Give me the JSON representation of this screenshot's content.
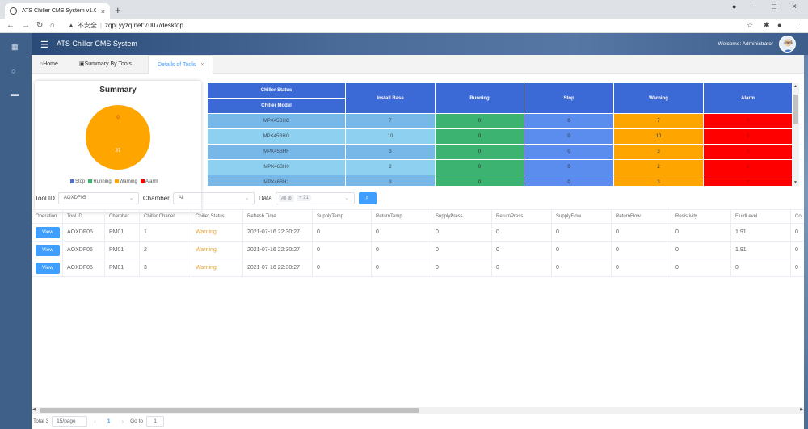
{
  "browser": {
    "tab_title": "ATS Chiller CMS System v1.0",
    "tab_close": "×",
    "new_tab": "+",
    "security_label": "不安全",
    "separator": "|",
    "url": "zqpj.yyzq.net:7007/desktop",
    "window_min": "−",
    "window_max": "□",
    "window_close": "×"
  },
  "header": {
    "title": "ATS Chiller CMS System",
    "welcome": "Welcome: Administrator"
  },
  "page_tabs": [
    {
      "label": "Home",
      "icon": "home-icon"
    },
    {
      "label": "Summary By Tools",
      "icon": "calendar-icon"
    },
    {
      "label": "Details of Tools",
      "close": "×"
    }
  ],
  "summary": {
    "title": "Summary",
    "labels": {
      "top": "0",
      "center": "37"
    },
    "legend": [
      {
        "label": "Stop",
        "color": "#5470c6"
      },
      {
        "label": "Running",
        "color": "#3cb371"
      },
      {
        "label": "Warning",
        "color": "#ffa500"
      },
      {
        "label": "Alarm",
        "color": "#ff0000"
      }
    ]
  },
  "chart_data": {
    "type": "pie",
    "title": "Summary",
    "categories": [
      "Stop",
      "Running",
      "Warning",
      "Alarm"
    ],
    "values": [
      0,
      0,
      37,
      0
    ],
    "legend_position": "bottom"
  },
  "status_grid": {
    "header_top": "Chiller Status",
    "header_sub": "Chiller Model",
    "columns": [
      "Install Base",
      "Running",
      "Stop",
      "Warning",
      "Alarm"
    ],
    "rows": [
      {
        "model": "MPX45BHC",
        "values": [
          "7",
          "0",
          "0",
          "7",
          "0"
        ]
      },
      {
        "model": "MPX45BHG",
        "values": [
          "10",
          "0",
          "0",
          "10",
          "0"
        ]
      },
      {
        "model": "MPX45BHF",
        "values": [
          "3",
          "0",
          "0",
          "3",
          "0"
        ]
      },
      {
        "model": "MPX46BH0",
        "values": [
          "2",
          "0",
          "0",
          "2",
          "0"
        ]
      },
      {
        "model": "MPX46BH1",
        "values": [
          "3",
          "0",
          "0",
          "3",
          "0"
        ]
      }
    ],
    "colors": {
      "model_even": "#77b8e8",
      "model_odd": "#8ed0ef",
      "install_even": "#77b8e8",
      "install_odd": "#8ed0ef",
      "running": "#3cb371",
      "stop": "#5b8def",
      "warning": "#ffa500",
      "alarm": "#ff0000"
    }
  },
  "filters": {
    "tool_id_label": "Tool ID",
    "tool_id_value": "AOXDF05",
    "chamber_label": "Chamber",
    "chamber_value": "All",
    "data_label": "Data",
    "data_tag": "All",
    "data_tag_more": "+ 21"
  },
  "table": {
    "columns": [
      "Operation",
      "Tool ID",
      "Chamber",
      "Chiller Chanel",
      "Chiller Status",
      "Refresh Time",
      "SupplyTemp",
      "ReturnTemp",
      "SupplyPress",
      "ReturnPress",
      "SupplyFlow",
      "ReturnFlow",
      "Resistivity",
      "FluidLevel",
      "Co"
    ],
    "view_label": "View",
    "rows": [
      [
        "AOXDF05",
        "PM01",
        "1",
        "Warning",
        "2021-07-16 22:30:27",
        "0",
        "0",
        "0",
        "0",
        "0",
        "0",
        "0",
        "1.91",
        "0"
      ],
      [
        "AOXDF05",
        "PM01",
        "2",
        "Warning",
        "2021-07-16 22:30:27",
        "0",
        "0",
        "0",
        "0",
        "0",
        "0",
        "0",
        "1.91",
        "0"
      ],
      [
        "AOXDF05",
        "PM01",
        "3",
        "Warning",
        "2021-07-16 22:30:27",
        "0",
        "0",
        "0",
        "0",
        "0",
        "0",
        "0",
        "0",
        "0"
      ]
    ]
  },
  "pagination": {
    "total": "Total 3",
    "page_size": "15/page",
    "current_page": "1",
    "goto_label": "Go to",
    "goto_value": "1"
  }
}
